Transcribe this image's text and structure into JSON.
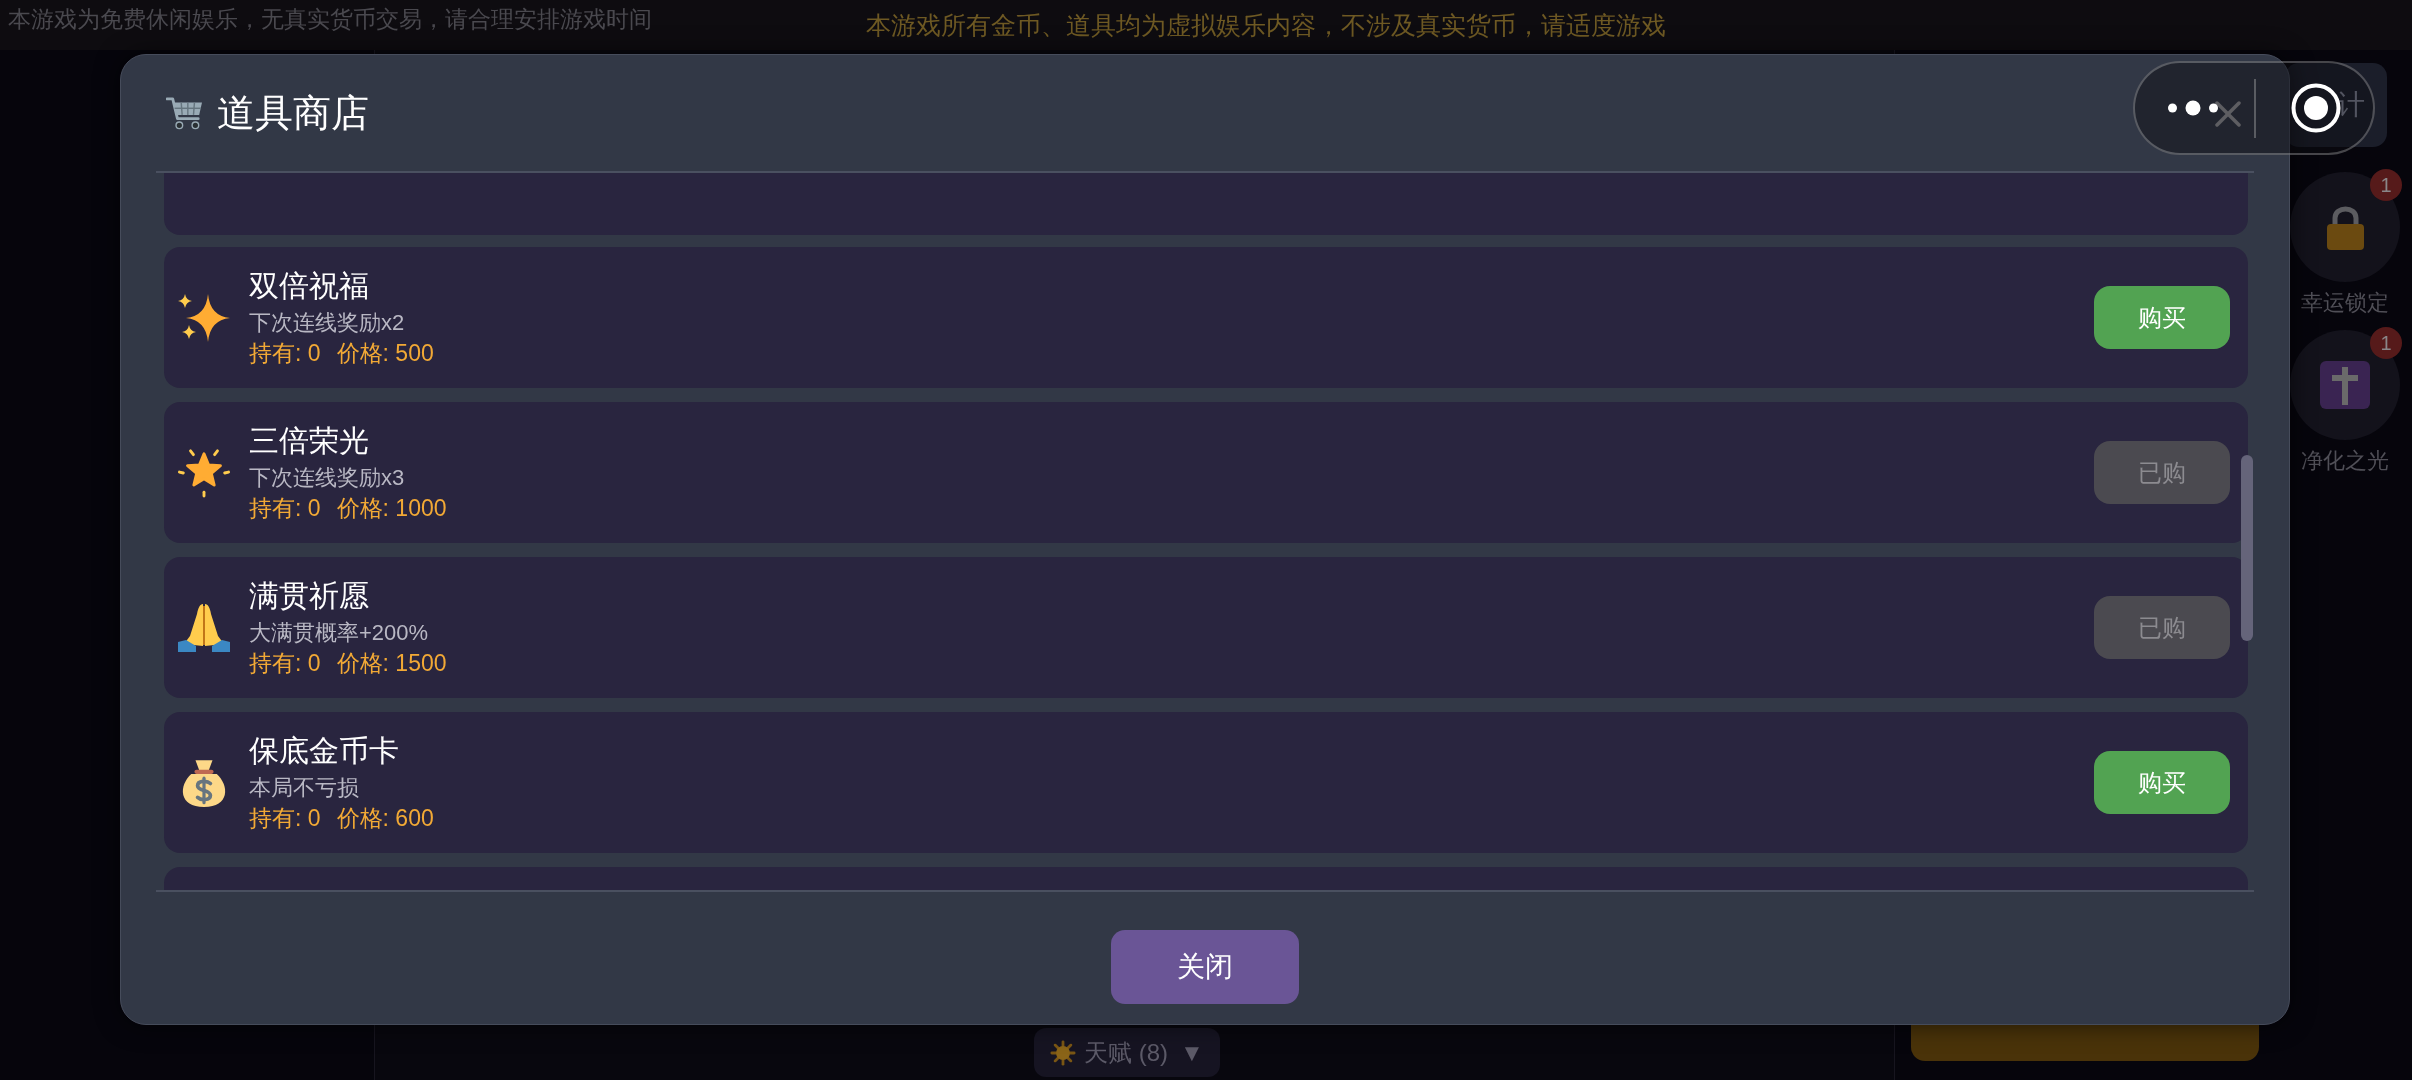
{
  "notices": {
    "left": "本游戏为免费休闲娱乐，无真实货币交易，请合理安排游戏时间",
    "center": "本游戏所有金币、道具均为虚拟娱乐内容，不涉及真实货币，请适度游戏"
  },
  "background": {
    "stats_button": "计",
    "side_items": [
      {
        "label": "幸运锁定",
        "badge": "1"
      },
      {
        "label": "净化之光",
        "badge": "1"
      }
    ],
    "talent_button": {
      "label": "天赋 (8)",
      "caret": "▼"
    }
  },
  "shop": {
    "title": "道具商店",
    "items": [
      {
        "name": "双倍祝福",
        "description": "下次连线奖励x2",
        "owned": "持有: 0",
        "price": "价格: 500",
        "button": "购买",
        "purchased": false
      },
      {
        "name": "三倍荣光",
        "description": "下次连线奖励x3",
        "owned": "持有: 0",
        "price": "价格: 1000",
        "button": "已购",
        "purchased": true
      },
      {
        "name": "满贯祈愿",
        "description": "大满贯概率+200%",
        "owned": "持有: 0",
        "price": "价格: 1500",
        "button": "已购",
        "purchased": true
      },
      {
        "name": "保底金币卡",
        "description": "本局不亏损",
        "owned": "持有: 0",
        "price": "价格: 600",
        "button": "购买",
        "purchased": false
      }
    ],
    "close_button": "关闭"
  }
}
